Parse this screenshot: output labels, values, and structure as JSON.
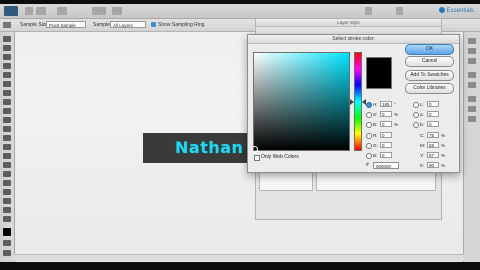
{
  "window": {
    "title": ""
  },
  "menubar": {
    "workspace": "Essentials"
  },
  "options": {
    "source_label": "Sample Size:",
    "source_value": "Point Sample",
    "sample_label": "Sample:",
    "sample_value": "All Layers",
    "show_ring_label": "Show Sampling Ring"
  },
  "layer_style_dialog": {
    "title": "Layer Style"
  },
  "canvas": {
    "banner_text": "Nathan",
    "banner_bg": "#3a3a3a",
    "banner_text_color": "#22d6ee"
  },
  "color_picker": {
    "title": "Select stroke color:",
    "buttons": {
      "ok": "OK",
      "cancel": "Cancel",
      "add_to_swatches": "Add To Swatches",
      "color_libraries": "Color Libraries"
    },
    "only_web_colors": "Only Web Colors",
    "hex_label": "#",
    "hex_value": "000000",
    "current_color": "#000000",
    "hue_color": "#00e5ff",
    "hsb": [
      {
        "label": "H:",
        "value": "185",
        "unit": "°",
        "selected": true
      },
      {
        "label": "S:",
        "value": "0",
        "unit": "%",
        "selected": false
      },
      {
        "label": "B:",
        "value": "0",
        "unit": "%",
        "selected": false
      }
    ],
    "rgb": [
      {
        "label": "R:",
        "value": "0",
        "selected": false
      },
      {
        "label": "G:",
        "value": "0",
        "selected": false
      },
      {
        "label": "B:",
        "value": "0",
        "selected": false
      }
    ],
    "lab": [
      {
        "label": "L:",
        "value": "0",
        "selected": false
      },
      {
        "label": "a:",
        "value": "0",
        "selected": false
      },
      {
        "label": "b:",
        "value": "0",
        "selected": false
      }
    ],
    "cmyk": [
      {
        "label": "C:",
        "value": "75",
        "unit": "%"
      },
      {
        "label": "M:",
        "value": "68",
        "unit": "%"
      },
      {
        "label": "Y:",
        "value": "67",
        "unit": "%"
      },
      {
        "label": "K:",
        "value": "90",
        "unit": "%"
      }
    ]
  }
}
